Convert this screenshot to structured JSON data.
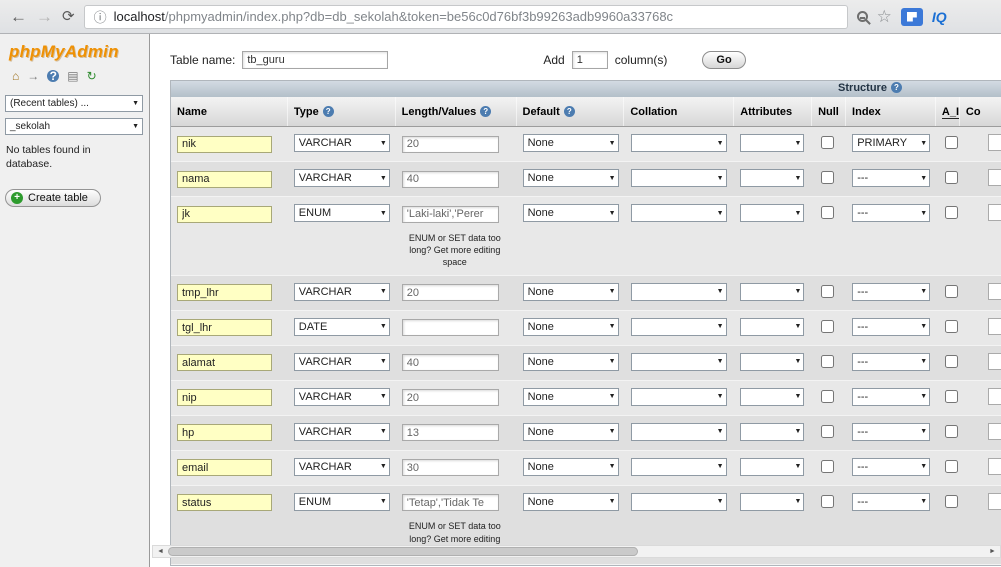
{
  "browser": {
    "url_host": "localhost",
    "url_rest": "/phpmyadmin/index.php?db=db_sekolah&token=be56c0d76bf3b99263adb9960a33768c",
    "extension_label": "IQ",
    "icons": {
      "back": "←",
      "forward": "→",
      "reload": "⟳",
      "info": "ⓘ",
      "star": "☆"
    }
  },
  "sidebar": {
    "logo": "phpMyAdmin",
    "icons": {
      "home": "⌂",
      "logout": "→",
      "help": "?",
      "docs": "▤",
      "reload": "↻"
    },
    "recent_tables_value": "(Recent tables) ...",
    "database_value": "_sekolah",
    "empty_message": "No tables found in database.",
    "create_table_label": "Create table",
    "select_arrow": "▼"
  },
  "main": {
    "table_name_label": "Table name:",
    "table_name_value": "tb_guru",
    "add_label": "Add",
    "add_value": "1",
    "columns_label": "column(s)",
    "go_label": "Go",
    "structure_title": "Structure",
    "help_glyph": "?",
    "select_arrow": "▼",
    "headers": [
      "Name",
      "Type",
      "Length/Values",
      "Default",
      "Collation",
      "Attributes",
      "Null",
      "Index",
      "A_I",
      "Co"
    ],
    "enum_note": "ENUM or SET data too long? Get more editing space",
    "rows": [
      {
        "name": "nik",
        "type": "VARCHAR",
        "length": "20",
        "default": "None",
        "index": "PRIMARY",
        "note": false
      },
      {
        "name": "nama",
        "type": "VARCHAR",
        "length": "40",
        "default": "None",
        "index": "---",
        "note": false
      },
      {
        "name": "jk",
        "type": "ENUM",
        "length": "'Laki-laki','Perer",
        "default": "None",
        "index": "---",
        "note": true
      },
      {
        "name": "tmp_lhr",
        "type": "VARCHAR",
        "length": "20",
        "default": "None",
        "index": "---",
        "note": false
      },
      {
        "name": "tgl_lhr",
        "type": "DATE",
        "length": "",
        "default": "None",
        "index": "---",
        "note": false
      },
      {
        "name": "alamat",
        "type": "VARCHAR",
        "length": "40",
        "default": "None",
        "index": "---",
        "note": false
      },
      {
        "name": "nip",
        "type": "VARCHAR",
        "length": "20",
        "default": "None",
        "index": "---",
        "note": false
      },
      {
        "name": "hp",
        "type": "VARCHAR",
        "length": "13",
        "default": "None",
        "index": "---",
        "note": false
      },
      {
        "name": "email",
        "type": "VARCHAR",
        "length": "30",
        "default": "None",
        "index": "---",
        "note": false
      },
      {
        "name": "status",
        "type": "ENUM",
        "length": "'Tetap','Tidak Te",
        "default": "None",
        "index": "---",
        "note": true
      }
    ]
  },
  "scrollbar": {
    "left_arrow": "◄",
    "right_arrow": "►"
  }
}
